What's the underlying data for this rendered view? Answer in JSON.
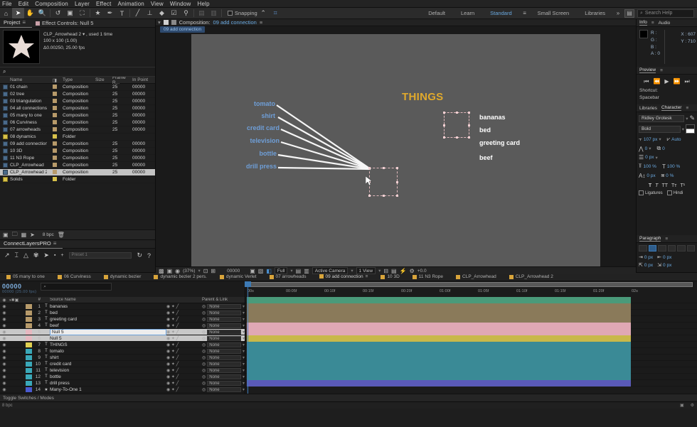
{
  "app": {
    "title": "Adobe After Effects"
  },
  "menubar": {
    "items": [
      "File",
      "Edit",
      "Composition",
      "Layer",
      "Effect",
      "Animation",
      "View",
      "Window",
      "Help"
    ]
  },
  "toolbar": {
    "tools": [
      {
        "name": "home-icon",
        "glyph": "⌂"
      },
      {
        "name": "selection-tool-icon",
        "glyph": "➤"
      },
      {
        "name": "hand-tool-icon",
        "glyph": "✋"
      },
      {
        "name": "zoom-tool-icon",
        "glyph": "🔍"
      },
      {
        "name": "rotation-tool-icon",
        "glyph": "↺"
      },
      {
        "name": "camera-tool-icon",
        "glyph": "🎥"
      },
      {
        "name": "pan-behind-tool-icon",
        "glyph": "⛶"
      },
      {
        "name": "shape-tool-icon",
        "glyph": "★"
      },
      {
        "name": "pen-tool-icon",
        "glyph": "✒"
      },
      {
        "name": "type-tool-icon",
        "glyph": "T"
      },
      {
        "name": "brush-tool-icon",
        "glyph": "╱"
      },
      {
        "name": "clone-stamp-tool-icon",
        "glyph": "⊥"
      },
      {
        "name": "eraser-tool-icon",
        "glyph": "◆"
      },
      {
        "name": "roto-brush-tool-icon",
        "glyph": "☑"
      },
      {
        "name": "puppet-tool-icon",
        "glyph": "⚲"
      }
    ],
    "snapping_label": "Snapping",
    "snap_icons": [
      "magnet-icon",
      "align-icon"
    ]
  },
  "workspace": {
    "tabs": [
      {
        "label": "Default",
        "selected": false
      },
      {
        "label": "Learn",
        "selected": false
      },
      {
        "label": "Standard",
        "selected": true
      },
      {
        "label": "Small Screen",
        "selected": false
      },
      {
        "label": "Libraries",
        "selected": false
      }
    ],
    "overflow_icon": "chevron-double-right-icon",
    "layout_icon": "workspace-layout-icon",
    "search_placeholder": "Search Help",
    "search_icon": "search-icon"
  },
  "project_panel": {
    "tabs": [
      {
        "label": "Project",
        "selected": true,
        "icon": "project-icon"
      },
      {
        "label": "Effect Controls: Null 5",
        "selected": false,
        "icon": "effect-controls-icon"
      }
    ],
    "selected_item": {
      "name": "CLP_Arrowhead 2",
      "usage": ", used 1 time",
      "dimensions": "100 x 100 (1.00)",
      "duration_fps": "Δ0.00250, 25.00 fps"
    },
    "thumbnail_icon": "star-shape-thumbnail",
    "search_placeholder": "",
    "search_icon": "search-icon",
    "columns": [
      "Name",
      "",
      "Type",
      "Size",
      "Frame R...",
      "In Point"
    ],
    "items": [
      {
        "name": "01 chain",
        "type": "Composition",
        "size": "",
        "frame_rate": "25",
        "in_point": "00000",
        "kind": "comp"
      },
      {
        "name": "02 tree",
        "type": "Composition",
        "size": "",
        "frame_rate": "25",
        "in_point": "00000",
        "kind": "comp"
      },
      {
        "name": "03 triangulation",
        "type": "Composition",
        "size": "",
        "frame_rate": "25",
        "in_point": "00000",
        "kind": "comp"
      },
      {
        "name": "04 all connections",
        "type": "Composition",
        "size": "",
        "frame_rate": "25",
        "in_point": "00000",
        "kind": "comp"
      },
      {
        "name": "05 many to one",
        "type": "Composition",
        "size": "",
        "frame_rate": "25",
        "in_point": "00000",
        "kind": "comp"
      },
      {
        "name": "06 Curviness",
        "type": "Composition",
        "size": "",
        "frame_rate": "25",
        "in_point": "00000",
        "kind": "comp"
      },
      {
        "name": "07 arrowheads",
        "type": "Composition",
        "size": "",
        "frame_rate": "25",
        "in_point": "00000",
        "kind": "comp"
      },
      {
        "name": "08 dynamics",
        "type": "Folder",
        "size": "",
        "frame_rate": "",
        "in_point": "",
        "kind": "folder"
      },
      {
        "name": "09 add connection",
        "type": "Composition",
        "size": "",
        "frame_rate": "25",
        "in_point": "00000",
        "kind": "comp"
      },
      {
        "name": "10 3D",
        "type": "Composition",
        "size": "",
        "frame_rate": "25",
        "in_point": "00000",
        "kind": "comp"
      },
      {
        "name": "11 N3 Rope",
        "type": "Composition",
        "size": "",
        "frame_rate": "25",
        "in_point": "00000",
        "kind": "comp"
      },
      {
        "name": "CLP_Arrowhead",
        "type": "Composition",
        "size": "",
        "frame_rate": "25",
        "in_point": "00000",
        "kind": "comp"
      },
      {
        "name": "CLP_Arrowhead 2",
        "type": "Composition",
        "size": "",
        "frame_rate": "25",
        "in_point": "00000",
        "kind": "comp",
        "selected": true
      },
      {
        "name": "Solids",
        "type": "Folder",
        "size": "",
        "frame_rate": "",
        "in_point": "",
        "kind": "folder"
      }
    ],
    "footer_icons": [
      "new-comp-icon",
      "new-folder-icon",
      "project-settings-icon",
      "interpret-footage-icon",
      "delete-icon"
    ],
    "bit_depth": "8 bpc"
  },
  "connect_layers_panel": {
    "title": "ConnectLayersPRO",
    "icons": [
      "connect-arrow-icon",
      "connect-i-beam-icon",
      "triangle-icon",
      "spider-icon",
      "play-icon",
      "dot-icon",
      "plus-icon",
      "help-icon",
      "refresh-icon"
    ],
    "field_placeholder": "Preset 1"
  },
  "composition_panel": {
    "tab_prefix": "Composition:",
    "tab_name": "09 add connection",
    "breadcrumb": "09 add connection",
    "menu_icon": "panel-menu-icon"
  },
  "canvas": {
    "title": "THINGS",
    "title_color": "#e0a92c",
    "left_labels": [
      "tomato",
      "shirt",
      "credit card",
      "television",
      "bottle",
      "drill press"
    ],
    "left_label_color": "#6f9fd8",
    "right_labels": [
      "bananas",
      "bed",
      "greeting card",
      "beef"
    ],
    "right_label_color": "#ffffff",
    "background_color": "#5a5a5a",
    "connector_color": "#ffffff",
    "null_handle_color": "#f0cfd2",
    "cursor_icon": "mouse-cursor-icon"
  },
  "comp_footer": {
    "icons": [
      "toggle-transparency-icon",
      "render-region-icon",
      "comp-flowchart-icon"
    ],
    "zoom": "(37%)",
    "resolution": "Full",
    "timecode": "00000",
    "camera": "Active Camera",
    "views": "1 View",
    "exposure": "+0.0",
    "snapshot_icon": "camera-icon",
    "show_snapshot_icon": "show-snapshot-icon",
    "channel_icon": "channel-icon",
    "mask_icon": "mask-icon",
    "grid_icon": "grid-icon",
    "region_icon": "region-of-interest-icon",
    "transparency_icon": "transparency-grid-icon"
  },
  "info_panel": {
    "tabs": [
      {
        "label": "Info",
        "selected": true
      },
      {
        "label": "Audio",
        "selected": false
      }
    ],
    "r_label": "R :",
    "g_label": "G :",
    "b_label": "B :",
    "a_label": "A :",
    "r": "",
    "g": "",
    "b": "",
    "a": "0",
    "x_label": "X :",
    "y_label": "Y :",
    "x": "607",
    "y": "710"
  },
  "preview_panel": {
    "title": "Preview",
    "transport": [
      "first-frame-icon",
      "prev-frame-icon",
      "play-icon",
      "next-frame-icon",
      "last-frame-icon"
    ],
    "shortcut_label": "Shortcut:",
    "shortcut_value": "Spacebar"
  },
  "character_panel": {
    "tabs": [
      {
        "label": "Libraries",
        "selected": false
      },
      {
        "label": "Character",
        "selected": true
      }
    ],
    "font_family": "Ridley Grotesk",
    "font_style": "Bold",
    "font_size": "107 px",
    "leading": "Auto",
    "kerning": "0",
    "tracking": "0",
    "vertical_scale": "100 %",
    "horizontal_scale": "100 %",
    "baseline_shift": "0 px",
    "tsume": "0 %",
    "stroke_width": "0 px",
    "eyedropper_icon": "eyedropper-icon",
    "style_buttons": [
      "faux-bold",
      "faux-italic",
      "all-caps",
      "small-caps",
      "superscript",
      "subscript"
    ],
    "ligatures_label": "Ligatures",
    "hindi_label": "Hindi"
  },
  "paragraph_panel": {
    "title": "Paragraph",
    "align_buttons": [
      "align-left",
      "align-center",
      "align-right",
      "justify-last-left",
      "justify-last-center",
      "justify-last-right",
      "justify-all"
    ],
    "indent_left": "0 px",
    "indent_right": "0 px",
    "indent_first": "0 px",
    "space_before": "0 px",
    "space_after": "0 px"
  },
  "timeline": {
    "tabs": [
      {
        "label": "05 many to one",
        "selected": false
      },
      {
        "label": "06 Curviness",
        "selected": false
      },
      {
        "label": "dynamic bezier",
        "selected": false
      },
      {
        "label": "dynamic bezier 2 pers.",
        "selected": false
      },
      {
        "label": "dynamic Verlet",
        "selected": false
      },
      {
        "label": "07 arrowheads",
        "selected": false
      },
      {
        "label": "09 add connection",
        "selected": true
      },
      {
        "label": "10 3D",
        "selected": false
      },
      {
        "label": "11 N3 Rope",
        "selected": false
      },
      {
        "label": "CLP_Arrowhead",
        "selected": false
      },
      {
        "label": "CLP_Arrowhead 2",
        "selected": false
      }
    ],
    "current_time": "00000",
    "current_time_sub": "00000 (25.00 fps)",
    "search_placeholder": "",
    "columns": [
      "#",
      "Source Name",
      "Parent & Link"
    ],
    "parent_default": "None",
    "ruler_ticks": [
      "00s",
      "00:05f",
      "00:10f",
      "00:15f",
      "00:20f",
      "01:00f",
      "01:05f",
      "01:10f",
      "01:15f",
      "01:20f",
      "02s"
    ],
    "layers": [
      {
        "num": "1",
        "name": "bananas",
        "type": "T",
        "color": "#b79a6a",
        "parent": "None",
        "barcolor": "#4a9a7a"
      },
      {
        "num": "2",
        "name": "bed",
        "type": "T",
        "color": "#b79a6a",
        "parent": "None",
        "barcolor": "#8a7a5a"
      },
      {
        "num": "3",
        "name": "greeting card",
        "type": "T",
        "color": "#b79a6a",
        "parent": "None",
        "barcolor": "#8a7a5a"
      },
      {
        "num": "4",
        "name": "beef",
        "type": "T",
        "color": "#b79a6a",
        "parent": "None",
        "barcolor": "#8a7a5a"
      },
      {
        "num": "5",
        "name": "Null 5",
        "type": "N",
        "color": "#e6b8c0",
        "parent": "None",
        "barcolor": "#e0a8b4",
        "selected": true,
        "editing": true
      },
      {
        "num": "6",
        "name": "Null 5",
        "type": "N",
        "color": "#e6b8c0",
        "parent": "None",
        "barcolor": "#e0a8b4",
        "selected": true
      },
      {
        "num": "7",
        "name": "THINGS",
        "type": "T",
        "color": "#e0d050",
        "parent": "None",
        "barcolor": "#c8b84a"
      },
      {
        "num": "8",
        "name": "tomato",
        "type": "T",
        "color": "#3aa8b8",
        "parent": "None",
        "barcolor": "#3a8a96"
      },
      {
        "num": "9",
        "name": "shirt",
        "type": "T",
        "color": "#3aa8b8",
        "parent": "None",
        "barcolor": "#3a8a96"
      },
      {
        "num": "10",
        "name": "credit card",
        "type": "T",
        "color": "#3aa8b8",
        "parent": "None",
        "barcolor": "#3a8a96"
      },
      {
        "num": "11",
        "name": "television",
        "type": "T",
        "color": "#3aa8b8",
        "parent": "None",
        "barcolor": "#3a8a96"
      },
      {
        "num": "12",
        "name": "bottle",
        "type": "T",
        "color": "#3aa8b8",
        "parent": "None",
        "barcolor": "#3a8a96"
      },
      {
        "num": "13",
        "name": "drill press",
        "type": "T",
        "color": "#3aa8b8",
        "parent": "None",
        "barcolor": "#3a8a96"
      },
      {
        "num": "14",
        "name": "Many-To-One 1",
        "type": "★",
        "color": "#4a5ad0",
        "parent": "None",
        "barcolor": "#5a5ab8"
      }
    ],
    "footer_label": "Toggle Switches / Modes"
  },
  "statusbar": {
    "bit_depth": "8 bpc",
    "icons": [
      "render-icon",
      "settings-icon",
      "search-icon"
    ]
  }
}
